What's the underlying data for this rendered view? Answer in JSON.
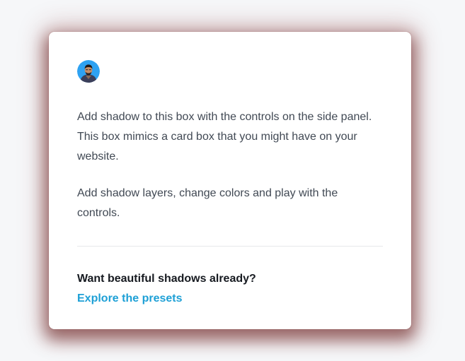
{
  "card": {
    "avatar_icon": "user-avatar",
    "paragraphs": [
      "Add shadow to this box with the controls on the side panel. This box mimics a card box that you might have on your website.",
      "Add shadow layers, change colors and play with the controls."
    ],
    "cta_title": "Want beautiful shadows already?",
    "cta_link_label": "Explore the presets"
  },
  "colors": {
    "page_background": "#f6f7f9",
    "card_background": "#ffffff",
    "shadow": "#6e1414",
    "body_text": "#414954",
    "heading_text": "#161a20",
    "link": "#1ea0d6",
    "avatar_background": "#2ea2f2"
  }
}
